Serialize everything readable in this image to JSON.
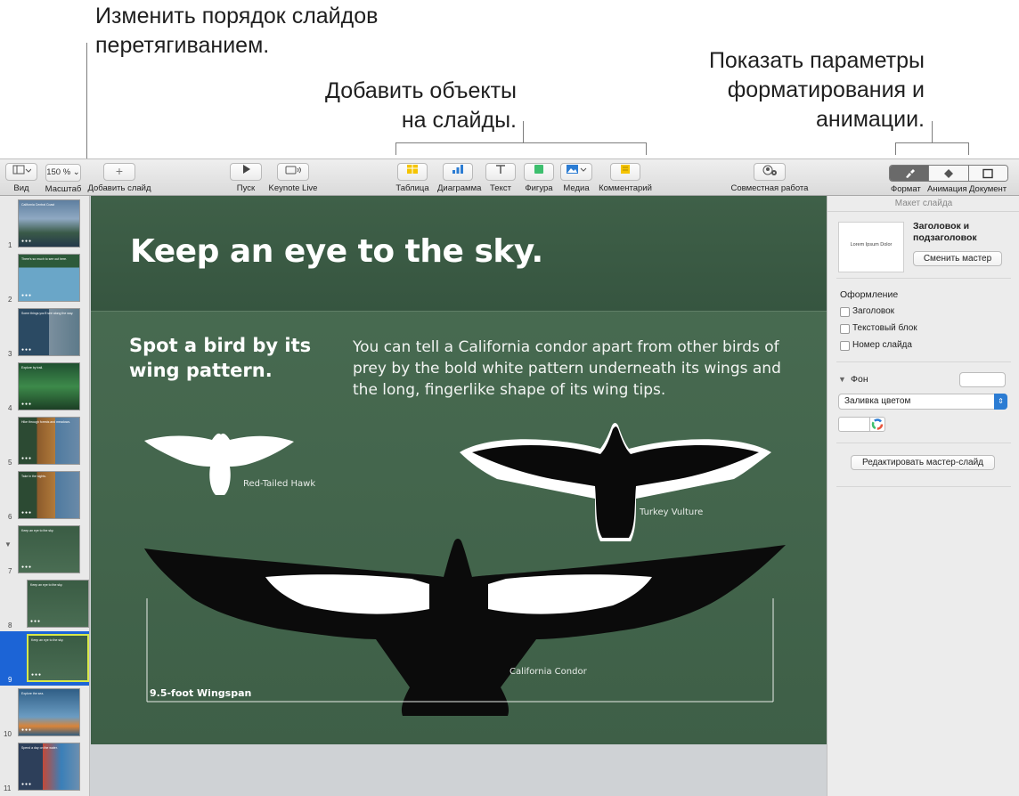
{
  "callouts": {
    "reorder_line1": "Изменить порядок слайдов",
    "reorder_line2": "перетягиванием.",
    "add_line1": "Добавить объекты",
    "add_line2": "на слайды.",
    "format_line1": "Показать параметры",
    "format_line2": "форматирования и",
    "format_line3": "анимации."
  },
  "toolbar": {
    "view_label": "Вид",
    "zoom_value": "150 %",
    "zoom_label": "Масштаб",
    "add_slide_label": "Добавить слайд",
    "play_label": "Пуск",
    "keynote_live_label": "Keynote Live",
    "table_label": "Таблица",
    "chart_label": "Диаграмма",
    "text_label": "Текст",
    "shape_label": "Фигура",
    "media_label": "Медиа",
    "comment_label": "Комментарий",
    "collaborate_label": "Совместная работа",
    "format_label": "Формат",
    "animate_label": "Анимация",
    "document_label": "Документ",
    "accent_yellow": "#f5c400",
    "accent_blue": "#2b7cd3",
    "accent_green": "#3dbf6e"
  },
  "navigator": {
    "selected": "9",
    "slides": [
      {
        "num": "1",
        "theme": "coast",
        "caption": "California Central Coast"
      },
      {
        "num": "2",
        "theme": "map",
        "caption": "There's so much to see out here."
      },
      {
        "num": "3",
        "theme": "list",
        "caption": "Some things you'll see along the way."
      },
      {
        "num": "4",
        "theme": "forest",
        "caption": "Explore by trail."
      },
      {
        "num": "5",
        "theme": "photos",
        "caption": "Hike through forests and meadows."
      },
      {
        "num": "6",
        "theme": "photos",
        "caption": "Take in the sights."
      },
      {
        "num": "7",
        "theme": "sky",
        "caption": "Keep an eye to the sky."
      },
      {
        "num": "8",
        "theme": "birds",
        "caption": "Keep an eye to the sky."
      },
      {
        "num": "9",
        "theme": "birds",
        "caption": "Keep an eye to the sky."
      },
      {
        "num": "10",
        "theme": "sea",
        "caption": "Explore the sea."
      },
      {
        "num": "11",
        "theme": "reef",
        "caption": "Spend a day on the water."
      }
    ]
  },
  "slide": {
    "title": "Keep an eye to the sky.",
    "subtitle": "Spot a bird by its wing pattern.",
    "body": "You can tell a California condor apart from other birds of prey by the bold white pattern underneath its wings and the long, fingerlike shape of its wing tips.",
    "hawk_label": "Red-Tailed Hawk",
    "vulture_label": "Turkey Vulture",
    "condor_label": "California Condor",
    "wingspan_label": "9.5-foot Wingspan",
    "background_color": "#466a4f"
  },
  "inspector": {
    "header": "Макет слайда",
    "master_thumb_text": "Lorem Ipsum Dolor",
    "master_name": "Заголовок и подзаголовок",
    "change_master_button": "Сменить мастер",
    "appearance_title": "Оформление",
    "checkboxes": [
      {
        "label": "Заголовок",
        "checked": false
      },
      {
        "label": "Текстовый блок",
        "checked": false
      },
      {
        "label": "Номер слайда",
        "checked": false
      }
    ],
    "background_title": "Фон",
    "fill_select": "Заливка цветом",
    "edit_master_button": "Редактировать мастер-слайд"
  }
}
